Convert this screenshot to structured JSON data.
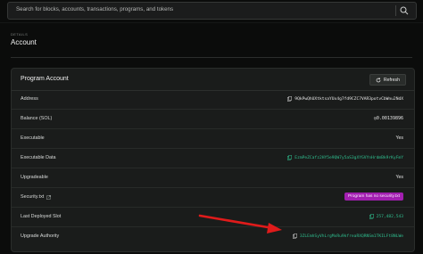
{
  "search": {
    "placeholder": "Search for blocks, accounts, transactions, programs, and tokens"
  },
  "header": {
    "section": "DETAILS",
    "title": "Account"
  },
  "card": {
    "title": "Program Account",
    "refresh_label": "Refresh",
    "rows": [
      {
        "label": "Address",
        "value": "9QkPwQhUXtktsaYUx4g7fd9CZC7VAR3potvCbWnu2NdX"
      },
      {
        "label": "Balance (SOL)",
        "value": "◎0.00139896"
      },
      {
        "label": "Executable",
        "value": "Yes"
      },
      {
        "label": "Executable Data",
        "value": "EzmPeZCafz2HY5e9QW7y5aS3gXYGVYnHrdmBk9rKyFmY"
      },
      {
        "label": "Upgradeable",
        "value": "Yes"
      },
      {
        "label": "Security.txt",
        "value": "Program has no security.txt"
      },
      {
        "label": "Last Deployed Slot",
        "value": "257,482,543"
      },
      {
        "label": "Upgrade Authority",
        "value": "3ZLEmhSyVhLrgMxRu9kfreaRXQRNSm1TKILFt8NLWe"
      }
    ]
  },
  "colors": {
    "accent": "#2fbf8f",
    "badge": "#a21fb0",
    "arrow": "#e01b1b"
  }
}
